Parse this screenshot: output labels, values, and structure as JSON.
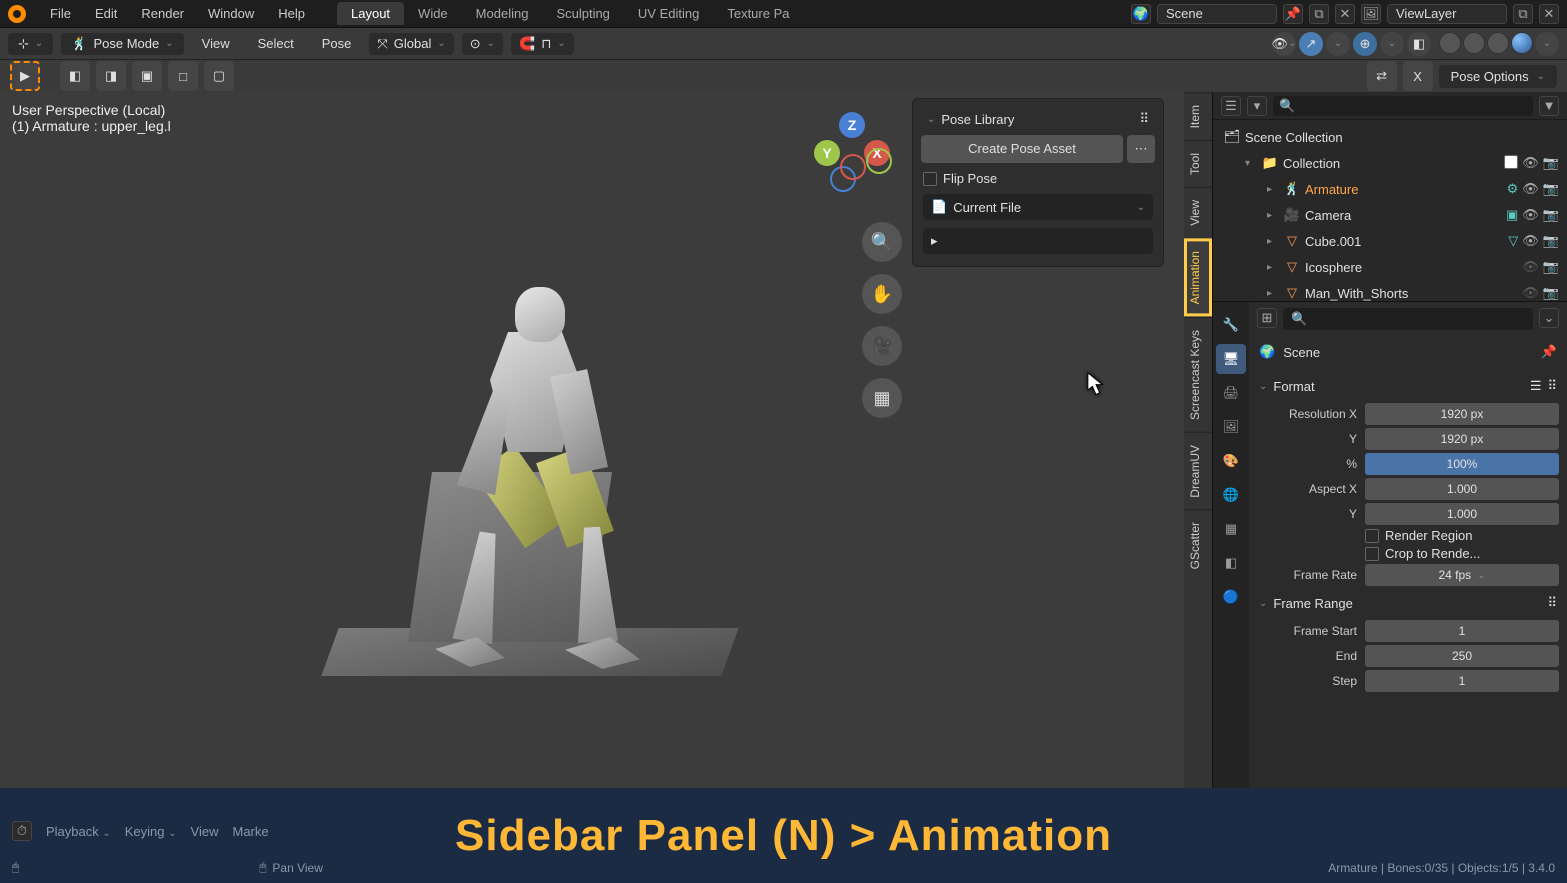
{
  "top_menu": {
    "items": [
      "File",
      "Edit",
      "Render",
      "Window",
      "Help"
    ]
  },
  "workspaces": {
    "tabs": [
      "Layout",
      "Wide",
      "Modeling",
      "Sculpting",
      "UV Editing",
      "Texture Pa"
    ],
    "active": 0
  },
  "scene": {
    "label": "Scene",
    "viewlayer": "ViewLayer"
  },
  "mode": {
    "label": "Pose Mode"
  },
  "viewport_menus": [
    "View",
    "Select",
    "Pose"
  ],
  "orientation": "Global",
  "pose_options_label": "Pose Options",
  "viewport_info": {
    "line1": "User Perspective (Local)",
    "line2": "(1) Armature : upper_leg.l"
  },
  "gizmo": {
    "x": "X",
    "y": "Y",
    "z": "Z"
  },
  "pose_library": {
    "title": "Pose Library",
    "create_btn": "Create Pose Asset",
    "flip_label": "Flip Pose",
    "catalog": "Current File"
  },
  "vtabs": [
    "Item",
    "Tool",
    "View",
    "Animation",
    "Screencast Keys",
    "DreamUV",
    "GScatter"
  ],
  "outliner": {
    "root": "Scene Collection",
    "collection": "Collection",
    "items": [
      {
        "name": "Armature",
        "type": "arm",
        "selected": true
      },
      {
        "name": "Camera",
        "type": "cam"
      },
      {
        "name": "Cube.001",
        "type": "mesh"
      },
      {
        "name": "Icosphere",
        "type": "mesh"
      },
      {
        "name": "Man_With_Shorts",
        "type": "mesh"
      }
    ],
    "search_placeholder": ""
  },
  "props": {
    "scene_label": "Scene",
    "format_label": "Format",
    "res_x_label": "Resolution X",
    "res_x": "1920 px",
    "res_y_label": "Y",
    "res_y": "1920 px",
    "pct_label": "%",
    "pct": "100%",
    "aspect_x_label": "Aspect X",
    "aspect_x": "1.000",
    "aspect_y_label": "Y",
    "aspect_y": "1.000",
    "render_region": "Render Region",
    "crop": "Crop to Rende...",
    "frame_rate_label": "Frame Rate",
    "frame_rate": "24 fps",
    "frame_range_label": "Frame Range",
    "frame_start_label": "Frame Start",
    "frame_start": "1",
    "frame_end_label": "End",
    "frame_end": "250",
    "frame_step_label": "Step",
    "frame_step": "1"
  },
  "timeline": {
    "items": [
      "Playback",
      "Keying",
      "View",
      "Marke"
    ]
  },
  "status": {
    "left_hint": "Pan View",
    "right": "Armature | Bones:0/35 | Objects:1/5 | 3.4.0"
  },
  "overlay_text": "Sidebar Panel (N) > Animation"
}
